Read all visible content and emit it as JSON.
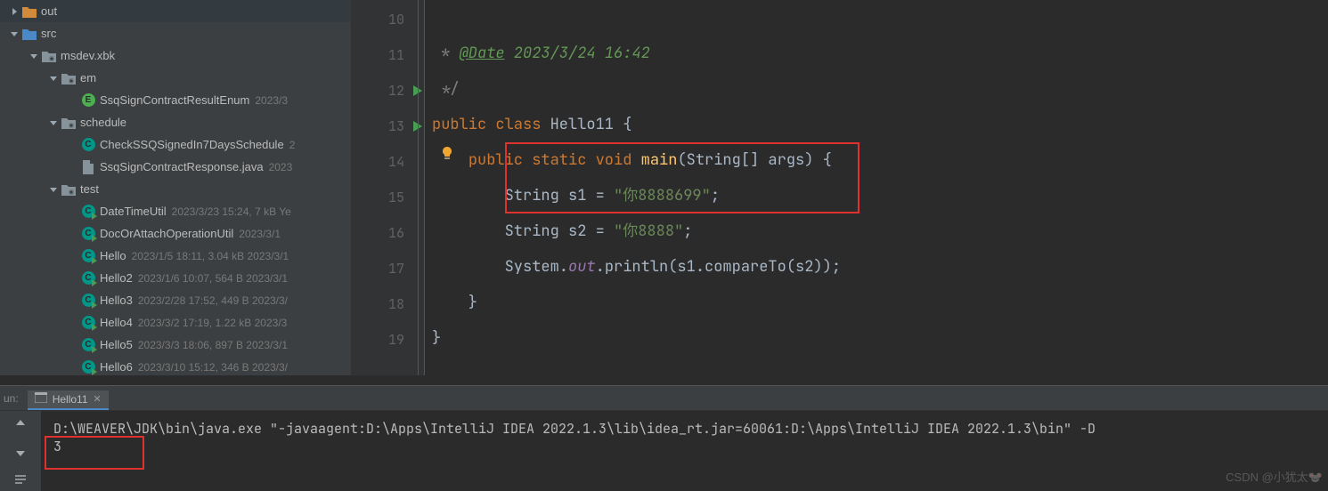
{
  "tree": [
    {
      "depth": 0,
      "arrow": "right",
      "icon": "folder-orange",
      "label": "out",
      "hint": ""
    },
    {
      "depth": 0,
      "arrow": "down",
      "icon": "folder-blue",
      "label": "src",
      "hint": ""
    },
    {
      "depth": 1,
      "arrow": "down",
      "icon": "pkg",
      "label": "msdev.xbk",
      "hint": ""
    },
    {
      "depth": 2,
      "arrow": "down",
      "icon": "pkg",
      "label": "em",
      "hint": ""
    },
    {
      "depth": 3,
      "arrow": "",
      "icon": "enum",
      "label": "SsqSignContractResultEnum",
      "hint": "2023/3"
    },
    {
      "depth": 2,
      "arrow": "down",
      "icon": "pkg",
      "label": "schedule",
      "hint": ""
    },
    {
      "depth": 3,
      "arrow": "",
      "icon": "class",
      "label": "CheckSSQSignedIn7DaysSchedule",
      "hint": "2"
    },
    {
      "depth": 3,
      "arrow": "",
      "icon": "jfile",
      "label": "SsqSignContractResponse.java",
      "hint": "2023"
    },
    {
      "depth": 2,
      "arrow": "down",
      "icon": "pkg",
      "label": "test",
      "hint": ""
    },
    {
      "depth": 3,
      "arrow": "",
      "icon": "class-run",
      "label": "DateTimeUtil",
      "hint": "2023/3/23 15:24, 7 kB Ye"
    },
    {
      "depth": 3,
      "arrow": "",
      "icon": "class-run",
      "label": "DocOrAttachOperationUtil",
      "hint": "2023/3/1"
    },
    {
      "depth": 3,
      "arrow": "",
      "icon": "class-run",
      "label": "Hello",
      "hint": "2023/1/5 18:11, 3.04 kB 2023/3/1"
    },
    {
      "depth": 3,
      "arrow": "",
      "icon": "class-run",
      "label": "Hello2",
      "hint": "2023/1/6 10:07, 564 B 2023/3/1"
    },
    {
      "depth": 3,
      "arrow": "",
      "icon": "class-run",
      "label": "Hello3",
      "hint": "2023/2/28 17:52, 449 B 2023/3/"
    },
    {
      "depth": 3,
      "arrow": "",
      "icon": "class-run",
      "label": "Hello4",
      "hint": "2023/3/2 17:19, 1.22 kB 2023/3"
    },
    {
      "depth": 3,
      "arrow": "",
      "icon": "class-run",
      "label": "Hello5",
      "hint": "2023/3/3 18:06, 897 B 2023/3/1"
    },
    {
      "depth": 3,
      "arrow": "",
      "icon": "class-run",
      "label": "Hello6",
      "hint": "2023/3/10 15:12, 346 B 2023/3/"
    }
  ],
  "gutter": [
    "10",
    "11",
    "12",
    "13",
    "14",
    "15",
    "16",
    "17",
    "18",
    "19"
  ],
  "gutter_run_rows": [
    2,
    3
  ],
  "code": {
    "l10": {
      "pre": " * ",
      "tag": "@Date",
      "rest": " 2023/3/24 16:42"
    },
    "l11": " */",
    "l12": {
      "kw1": "public class ",
      "name": "Hello11 ",
      "brace": "{"
    },
    "l13": {
      "indent": "    ",
      "kw": "public static void ",
      "fn": "main",
      "sig": "(String[] args) {"
    },
    "l14": {
      "indent": "        ",
      "t": "String s1 = ",
      "s": "\"你8888699\"",
      "semi": ";"
    },
    "l15": {
      "indent": "        ",
      "t": "String s2 = ",
      "s": "\"你8888\"",
      "semi": ";"
    },
    "l16": {
      "indent": "        ",
      "a": "System.",
      "b": "out",
      "c": ".println(s1.compareTo(s2));"
    },
    "l17": "    }",
    "l18": "}",
    "l19": ""
  },
  "run": {
    "panel_label": "un:",
    "tab_name": "Hello11",
    "cmd": "D:\\WEAVER\\JDK\\bin\\java.exe \"-javaagent:D:\\Apps\\IntelliJ IDEA 2022.1.3\\lib\\idea_rt.jar=60061:D:\\Apps\\IntelliJ IDEA 2022.1.3\\bin\" -D",
    "output": "3"
  },
  "watermark": "CSDN @小犹太🐭"
}
